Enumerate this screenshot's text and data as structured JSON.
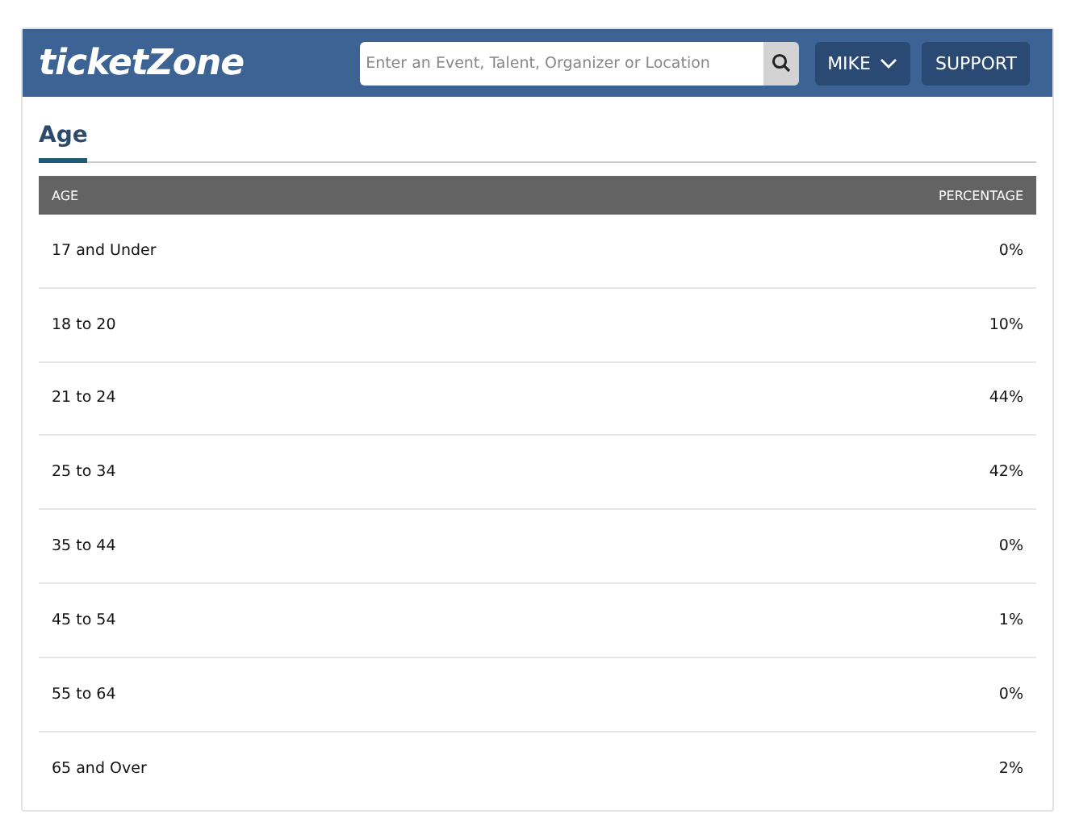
{
  "header": {
    "logo": "ticketZone",
    "search": {
      "placeholder": "Enter an Event, Talent, Organizer or Location"
    },
    "user_menu": "MIKE",
    "support": "SUPPORT"
  },
  "tabs": [
    {
      "label": "Age",
      "selected": true
    }
  ],
  "table": {
    "columns": [
      "AGE",
      "PERCENTAGE"
    ],
    "rows": [
      [
        "17 and Under",
        "0%"
      ],
      [
        "18 to 20",
        "10%"
      ],
      [
        "21 to 24",
        "44%"
      ],
      [
        "25 to 34",
        "42%"
      ],
      [
        "35 to 44",
        "0%"
      ],
      [
        "45 to 54",
        "1%"
      ],
      [
        "55 to 64",
        "0%"
      ],
      [
        "65 and Over",
        "2%"
      ]
    ]
  }
}
